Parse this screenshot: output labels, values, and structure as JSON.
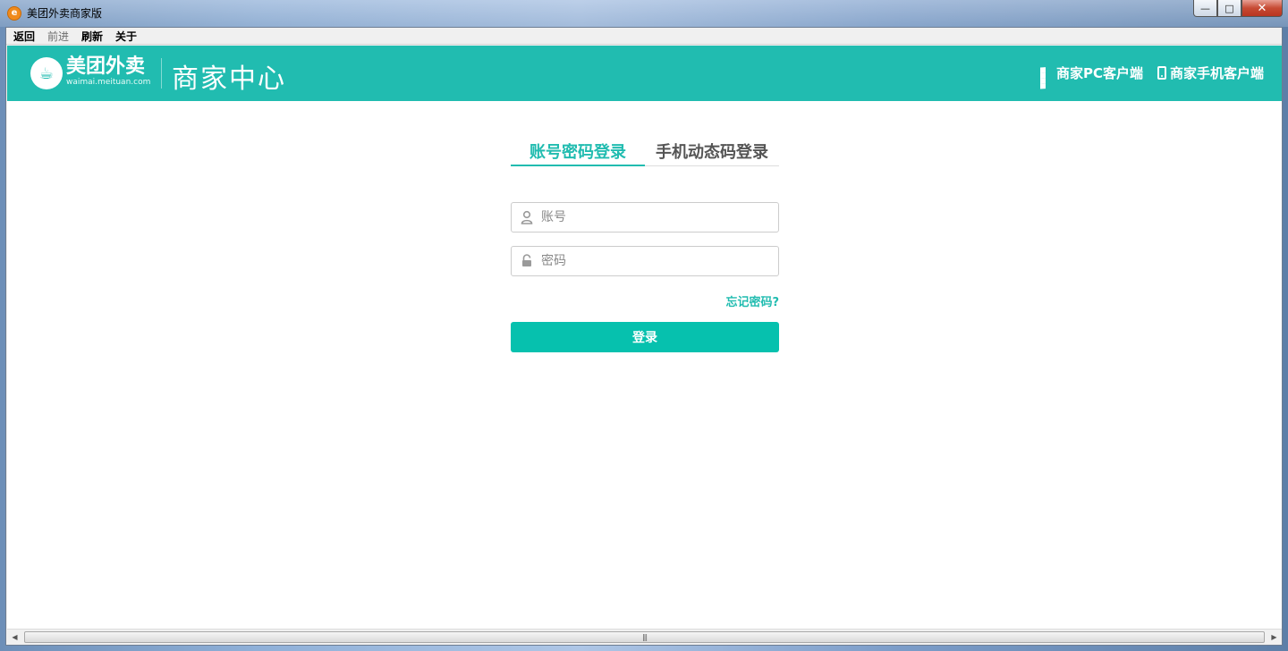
{
  "window": {
    "title": "美团外卖商家版",
    "app_icon": "美团外卖 logo",
    "controls": {
      "minimize": "—",
      "maximize": "□",
      "close": "✕"
    }
  },
  "menu": {
    "items": [
      {
        "label": "返回",
        "enabled": true
      },
      {
        "label": "前进",
        "enabled": false
      },
      {
        "label": "刷新",
        "enabled": true
      },
      {
        "label": "关于",
        "enabled": true
      }
    ]
  },
  "header": {
    "brand_name": "美团外卖",
    "brand_domain": "waimai.meituan.com",
    "center_title": "商家中心",
    "pc_client": "商家PC客户端",
    "mobile_client": "商家手机客户端",
    "accent_color": "#21bcb0"
  },
  "login": {
    "tabs": [
      "账号密码登录",
      "手机动态码登录"
    ],
    "active_tab": 0,
    "account_placeholder": "账号",
    "password_placeholder": "密码",
    "forgot_link": "忘记密码?",
    "submit_label": "登录",
    "button_color": "#06c1ae"
  },
  "scrollbar": {
    "left_arrow": "◀",
    "right_arrow": "▶",
    "grip": "|||"
  }
}
